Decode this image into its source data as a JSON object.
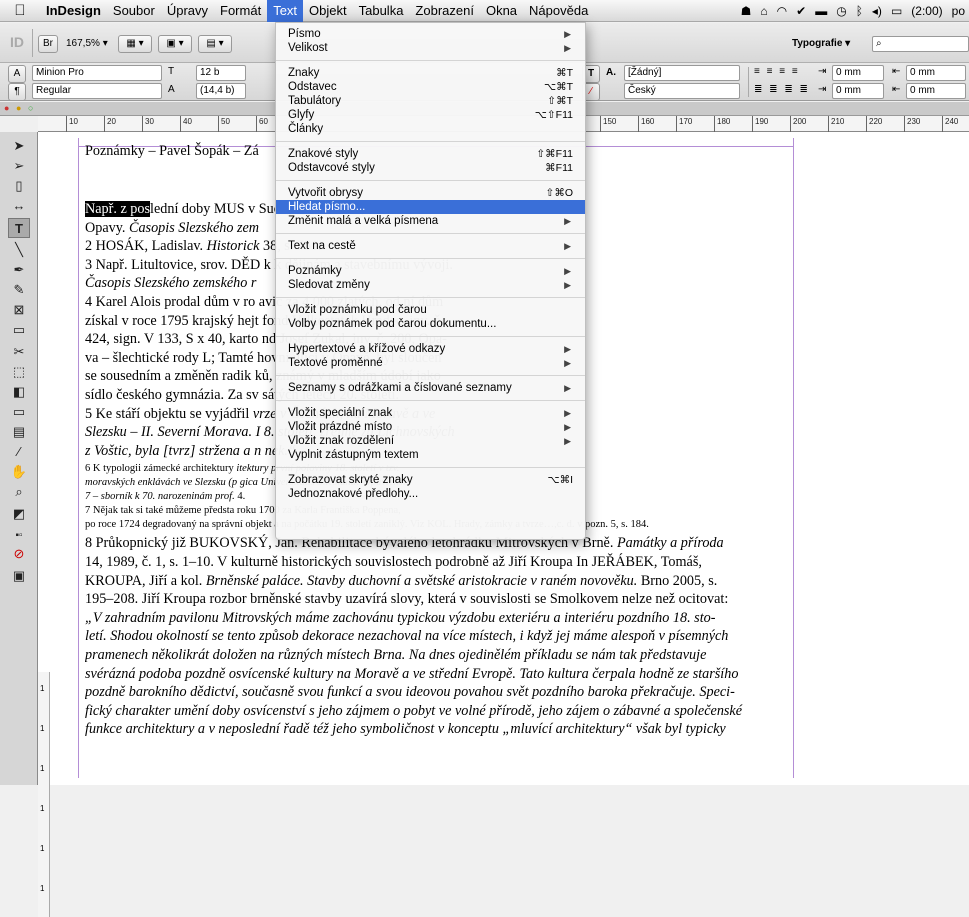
{
  "menubar": {
    "app": "InDesign",
    "items": [
      "Soubor",
      "Úpravy",
      "Formát",
      "Text",
      "Objekt",
      "Tabulka",
      "Zobrazení",
      "Okna",
      "Nápověda"
    ],
    "active": "Text",
    "battery": "(2:00)",
    "clock_partial": "po"
  },
  "toolbar": {
    "br_label": "Br",
    "zoom": "167,5%",
    "workspace": "Typografie",
    "search_placeholder": ""
  },
  "control": {
    "font_family": "Minion Pro",
    "font_style": "Regular",
    "font_size": "12 b",
    "leading": "(14,4 b)",
    "char_style": "[Žádný]",
    "language": "Český",
    "indent1": "0 mm",
    "indent2": "0 mm",
    "indent3": "0 mm",
    "indent4": "0 mm"
  },
  "ruler": {
    "ticks": [
      "10",
      "20",
      "30",
      "40",
      "50",
      "60",
      "150",
      "160",
      "170",
      "180",
      "190",
      "200",
      "210",
      "220",
      "230",
      "240"
    ],
    "vticks": [
      "1",
      "1",
      "1",
      "1",
      "1",
      "1"
    ]
  },
  "text_menu": [
    {
      "label": "Písmo",
      "shortcut": "",
      "arrow": true
    },
    {
      "label": "Velikost",
      "shortcut": "",
      "arrow": true
    },
    {
      "sep": true
    },
    {
      "label": "Znaky",
      "shortcut": "⌘T"
    },
    {
      "label": "Odstavec",
      "shortcut": "⌥⌘T"
    },
    {
      "label": "Tabulátory",
      "shortcut": "⇧⌘T"
    },
    {
      "label": "Glyfy",
      "shortcut": "⌥⇧F11"
    },
    {
      "label": "Články",
      "shortcut": ""
    },
    {
      "sep": true
    },
    {
      "label": "Znakové styly",
      "shortcut": "⇧⌘F11"
    },
    {
      "label": "Odstavcové styly",
      "shortcut": "⌘F11"
    },
    {
      "sep": true
    },
    {
      "label": "Vytvořit obrysy",
      "shortcut": "⇧⌘O"
    },
    {
      "label": "Hledat písmo...",
      "shortcut": "",
      "highlight": true
    },
    {
      "label": "Změnit malá a velká písmena",
      "shortcut": "",
      "arrow": true
    },
    {
      "sep": true
    },
    {
      "label": "Text na cestě",
      "shortcut": "",
      "arrow": true
    },
    {
      "sep": true
    },
    {
      "label": "Poznámky",
      "shortcut": "",
      "arrow": true
    },
    {
      "label": "Sledovat změny",
      "shortcut": "",
      "arrow": true
    },
    {
      "sep": true
    },
    {
      "label": "Vložit poznámku pod čarou",
      "shortcut": ""
    },
    {
      "label": "Volby poznámek pod čarou dokumentu...",
      "shortcut": ""
    },
    {
      "sep": true
    },
    {
      "label": "Hypertextové a křížové odkazy",
      "shortcut": "",
      "arrow": true
    },
    {
      "label": "Textové proměnné",
      "shortcut": "",
      "arrow": true
    },
    {
      "sep": true
    },
    {
      "label": "Seznamy s odrážkami a číslované seznamy",
      "shortcut": "",
      "arrow": true
    },
    {
      "sep": true
    },
    {
      "label": "Vložit speciální znak",
      "shortcut": "",
      "arrow": true
    },
    {
      "label": "Vložit prázdné místo",
      "shortcut": "",
      "arrow": true
    },
    {
      "label": "Vložit znak rozdělení",
      "shortcut": "",
      "arrow": true
    },
    {
      "label": "Vyplnit zástupným textem",
      "shortcut": ""
    },
    {
      "sep": true
    },
    {
      "label": "Zobrazovat skryté znaky",
      "shortcut": "⌥⌘I"
    },
    {
      "label": "Jednoznakové předlohy...",
      "shortcut": ""
    }
  ],
  "document": {
    "heading": "Poznámky – Pavel Šopák – Zá",
    "lines": [
      {
        "parts": [
          {
            "t": "Např. z pos",
            "hl": true
          },
          {
            "t": "lední doby MUS"
          },
          {
            "t": "                                                                     v Suchých Lazcích (část města"
          }
        ]
      },
      {
        "parts": [
          {
            "t": "Opavy. "
          },
          {
            "t": "Časopis Slezského zem",
            "it": true
          }
        ]
      },
      {
        "parts": [
          {
            "t": "2 HOSÁK, Ladislav. "
          },
          {
            "t": "Historick",
            "it": true
          },
          {
            "t": "                                                                      38, s. 751."
          }
        ]
      },
      {
        "parts": [
          {
            "t": "3 Např. Litultovice, srov. DĚD"
          },
          {
            "t": "                                                                     k k dějinám a stavebnímu vývoji."
          }
        ]
      },
      {
        "parts": [
          {
            "t": "Časopis Slezského zemského r",
            "it": true
          }
        ]
      },
      {
        "parts": [
          {
            "t": "4 Karel Alois prodal dům v ro"
          },
          {
            "t": "                                                                     avic za 4 000 zlatých, od ní dům"
          }
        ]
      },
      {
        "parts": [
          {
            "t": "získal v roce 1795 krajský hejt"
          },
          {
            "t": "                                                                     fond Velkostatek Hradec, inv. č."
          }
        ]
      },
      {
        "parts": [
          {
            "t": "424, sign. V 133, S x 40, karto"
          },
          {
            "t": "                                                                     nd Josef Zukal, inv. č. 200, Opa-"
          }
        ]
      },
      {
        "parts": [
          {
            "t": "va – šlechtické rody L; Tamté"
          },
          {
            "t": "                                                                     hovní ulici v Opavě, byl sloučen"
          }
        ]
      },
      {
        "parts": [
          {
            "t": "se sousedním a změněn radik"
          },
          {
            "t": "                                                                     ků, známý v mladším údobí jako"
          }
        ]
      },
      {
        "parts": [
          {
            "t": "sídlo českého gymnázia. Za sv"
          },
          {
            "t": "                                                                     sátých letech 20. století."
          }
        ]
      },
      {
        "parts": [
          {
            "t": "5 Ke stáří objektu se vyjádřil"
          },
          {
            "t": "                                                                     vrze v Čechách, na Moravě a ve",
            "it": true
          }
        ]
      },
      {
        "parts": [
          {
            "t": "Slezsku – II. Severní Morava. I",
            "it": true
          },
          {
            "t": "                                                                     8. století, zřejmě za Lichnovských",
            "it": true
          }
        ]
      },
      {
        "parts": [
          {
            "t": "z Voštic, byla [tvrz] stržena a n",
            "it": true
          },
          {
            "t": "                                                                     nek.“",
            "it": true
          }
        ]
      }
    ],
    "small_lines": [
      {
        "parts": [
          {
            "t": "6 K typologii zámecké architektury"
          },
          {
            "t": "                                                                                                 itektury první poloviny 18. století v tzv.",
            "it": true
          }
        ]
      },
      {
        "parts": [
          {
            "t": "moravských enklávách ve Slezsku (p",
            "it": true
          },
          {
            "t": "                                                                                                 gica Universitatis Silesianae Opaviensis",
            "it": true
          }
        ]
      },
      {
        "parts": [
          {
            "t": "7 – sborník k 70. narozeninám prof.",
            "it": true
          },
          {
            "t": "                                                                                                 4."
          }
        ]
      },
      {
        "parts": [
          {
            "t": "7 Nějak tak si také můžeme předsta"
          },
          {
            "t": "                                                                                                 roku 1700 za Karla Františka Poppena,"
          }
        ]
      },
      {
        "parts": [
          {
            "t": "po roce 1724 degradovaný na správní objekt a na počátku 19. století zaniklý. Viz KOL. Hrady, zámky a tvrze…,c. d. v pozn. 5, s. 184."
          }
        ]
      }
    ],
    "lines2": [
      {
        "parts": [
          {
            "t": "8 Průkopnický již BUKOVSKÝ, Jan. Rehabilitace bývalého letohrádku Mitrovských v Brně. "
          },
          {
            "t": "Památky a příroda",
            "it": true
          }
        ]
      },
      {
        "parts": [
          {
            "t": "14, 1989, č. 1, s. 1–10. V kulturně historických souvislostech podrobně až Jiří Kroupa In JEŘÁBEK, Tomáš,"
          }
        ]
      },
      {
        "parts": [
          {
            "t": "KROUPA, Jiří a kol. "
          },
          {
            "t": "Brněnské paláce. Stavby duchovní a světské aristokracie v raném novověku.",
            "it": true
          },
          {
            "t": " Brno 2005, s."
          }
        ]
      },
      {
        "parts": [
          {
            "t": "195–208. Jiří Kroupa rozbor brněnské stavby uzavírá slovy, která v souvislosti se Smolkovem nelze než ocitovat:"
          }
        ]
      },
      {
        "parts": [
          {
            "t": "„V zahradním pavilonu Mitrovských máme zachovánu typickou výzdobu exteriéru a interiéru pozdního 18. sto-",
            "it": true
          }
        ]
      },
      {
        "parts": [
          {
            "t": "letí. Shodou okolností se tento způsob dekorace nezachoval na více místech, i když jej máme alespoň v písemných",
            "it": true
          }
        ]
      },
      {
        "parts": [
          {
            "t": "pramenech několikrát doložen na různých místech Brna. Na dnes ojedinělém příkladu se nám tak představuje",
            "it": true
          }
        ]
      },
      {
        "parts": [
          {
            "t": "svérázná podoba pozdně osvícenské kultury na Moravě a ve střední Evropě. Tato kultura čerpala hodně ze staršího",
            "it": true
          }
        ]
      },
      {
        "parts": [
          {
            "t": "pozdně barokního dědictví, současně svou funkcí a svou ideovou povahou svět pozdního baroka překračuje. Speci-",
            "it": true
          }
        ]
      },
      {
        "parts": [
          {
            "t": "fický charakter umění doby osvícenství s jeho zájmem o pobyt ve volné přírodě, jeho zájem o zábavné a společenské",
            "it": true
          }
        ]
      },
      {
        "parts": [
          {
            "t": "funkce architektury a v neposlední řadě též jeho symboličnost v konceptu „mluvící architektury“ však byl typicky",
            "it": true
          }
        ]
      }
    ]
  },
  "colors": {
    "menu_highlight": "#3a6fd8",
    "frame_guide": "#b48ed6"
  }
}
